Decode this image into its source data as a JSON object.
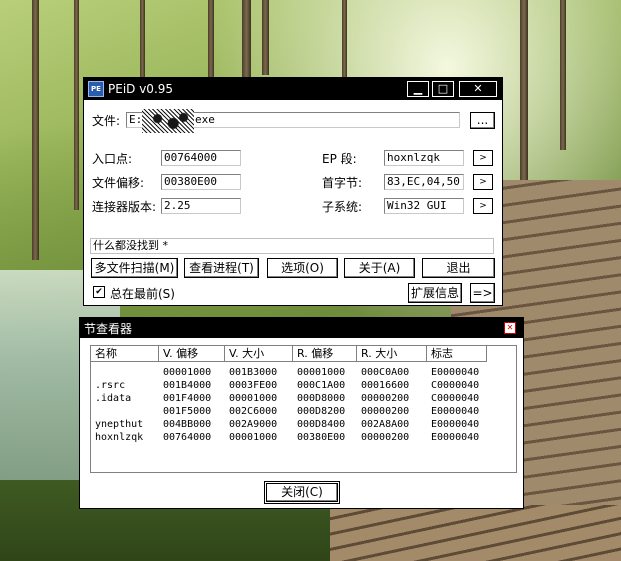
{
  "peid": {
    "title": "PEiD v0.95",
    "icon_text": "PE",
    "file_label": "文件:",
    "file_value": "E:",
    "file_ext": "exe",
    "browse_label": "...",
    "entry_label": "入口点:",
    "entry_value": "00764000",
    "offset_label": "文件偏移:",
    "offset_value": "00380E00",
    "linker_label": "连接器版本:",
    "linker_value": "2.25",
    "ep_label": "EP 段:",
    "ep_value": "hoxnlzqk",
    "firstbytes_label": "首字节:",
    "firstbytes_value": "83,EC,04,50",
    "subsystem_label": "子系统:",
    "subsystem_value": "Win32 GUI",
    "arrow": ">",
    "result": "什么都没找到  *",
    "buttons": {
      "multi_scan": "多文件扫描(M)",
      "process": "查看进程(T)",
      "options": "选项(O)",
      "about": "关于(A)",
      "exit": "退出",
      "ext_info": "扩展信息",
      "next": "=>"
    },
    "ontop_label": "总在最前(S)",
    "ontop_checked": "✔"
  },
  "sections": {
    "title": "节查看器",
    "close_x": "✕",
    "columns": [
      "名称",
      "V. 偏移",
      "V. 大小",
      "R. 偏移",
      "R. 大小",
      "标志"
    ],
    "rows": [
      [
        "",
        "00001000",
        "001B3000",
        "00001000",
        "000C0A00",
        "E0000040"
      ],
      [
        ".rsrc",
        "001B4000",
        "0003FE00",
        "000C1A00",
        "00016600",
        "C0000040"
      ],
      [
        ".idata",
        "001F4000",
        "00001000",
        "000D8000",
        "00000200",
        "C0000040"
      ],
      [
        "",
        "001F5000",
        "002C6000",
        "000D8200",
        "00000200",
        "E0000040"
      ],
      [
        "ynepthut",
        "004BB000",
        "002A9000",
        "000D8400",
        "002A8A00",
        "E0000040"
      ],
      [
        "hoxnlzqk",
        "00764000",
        "00001000",
        "00380E00",
        "00000200",
        "E0000040"
      ]
    ],
    "close_button": "关闭(C)"
  }
}
